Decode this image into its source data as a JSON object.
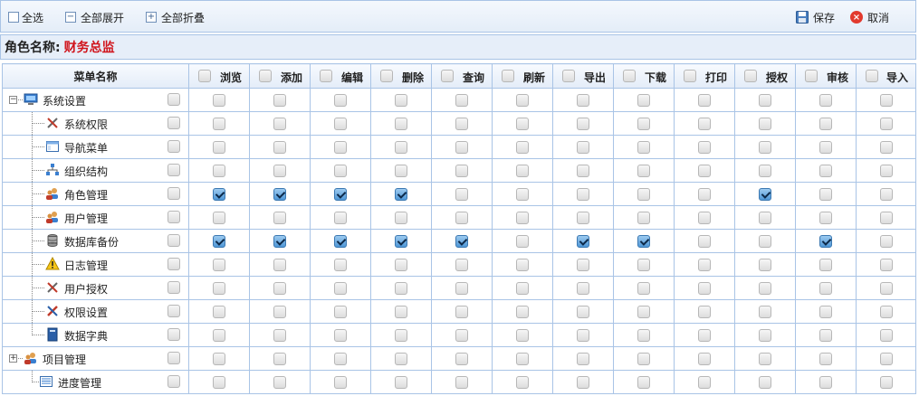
{
  "toolbar": {
    "select_all": "全选",
    "expand_all": "全部展开",
    "expand_icon": "−",
    "collapse_all": "全部折叠",
    "collapse_icon": "+",
    "save": "保存",
    "cancel": "取消"
  },
  "role": {
    "label": "角色名称:",
    "name": "财务总监"
  },
  "table": {
    "menu_header": "菜单名称",
    "permissions": [
      "浏览",
      "添加",
      "编辑",
      "删除",
      "查询",
      "刷新",
      "导出",
      "下载",
      "打印",
      "授权",
      "审核",
      "导入"
    ],
    "rows": [
      {
        "name": "系统设置",
        "level": 0,
        "icon": "computer-icon",
        "toggle": "−",
        "checked": []
      },
      {
        "name": "系统权限",
        "level": 1,
        "icon": "tools-icon",
        "checked": []
      },
      {
        "name": "导航菜单",
        "level": 1,
        "icon": "window-icon",
        "checked": []
      },
      {
        "name": "组织结构",
        "level": 1,
        "icon": "org-chart-icon",
        "checked": []
      },
      {
        "name": "角色管理",
        "level": 1,
        "icon": "users-icon",
        "checked": [
          0,
          1,
          2,
          3,
          9
        ]
      },
      {
        "name": "用户管理",
        "level": 1,
        "icon": "users-icon",
        "checked": []
      },
      {
        "name": "数据库备份",
        "level": 1,
        "icon": "database-icon",
        "checked": [
          0,
          1,
          2,
          3,
          4,
          6,
          7,
          10
        ]
      },
      {
        "name": "日志管理",
        "level": 1,
        "icon": "warning-icon",
        "checked": []
      },
      {
        "name": "用户授权",
        "level": 1,
        "icon": "tools-icon",
        "checked": []
      },
      {
        "name": "权限设置",
        "level": 1,
        "icon": "wrench-icon",
        "checked": []
      },
      {
        "name": "数据字典",
        "level": 1,
        "icon": "book-icon",
        "checked": []
      },
      {
        "name": "项目管理",
        "level": 0,
        "icon": "users-icon",
        "toggle": "+",
        "checked": []
      },
      {
        "name": "进度管理",
        "level": 1,
        "icon": "list-icon",
        "checked": []
      }
    ]
  },
  "colors": {
    "border": "#a9c4e6",
    "role_name": "#d0141c",
    "check_fill": "#4f97d6"
  }
}
